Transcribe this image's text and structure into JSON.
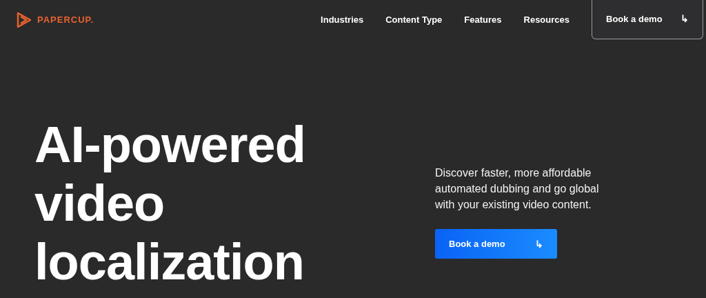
{
  "logo": {
    "text": "PAPERCUP."
  },
  "nav": [
    "Industries",
    "Content Type",
    "Features",
    "Resources"
  ],
  "nav_button": {
    "label": "Book a demo",
    "icon": "↳"
  },
  "hero": {
    "title_lines": [
      "AI-powered",
      "video",
      "localization"
    ],
    "description": "Discover faster, more affordable automated dubbing and go global with your existing video content.",
    "button": {
      "label": "Book a demo",
      "icon": "↳"
    }
  }
}
